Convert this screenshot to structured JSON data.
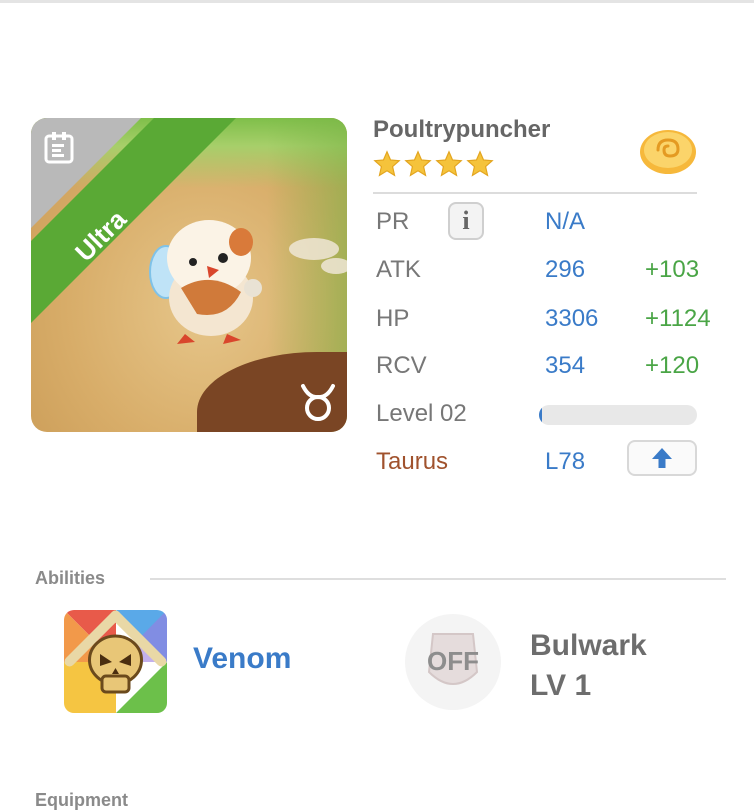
{
  "creature": {
    "name": "Poultrypuncher",
    "rarity": "Ultra",
    "star_count": 4,
    "star_color": "#f5c33b"
  },
  "stats": {
    "pr": {
      "label": "PR",
      "value": "N/A",
      "info_icon": "info-icon"
    },
    "atk": {
      "label": "ATK",
      "value": "296",
      "bonus": "+103"
    },
    "hp": {
      "label": "HP",
      "value": "3306",
      "bonus": "+1124"
    },
    "rcv": {
      "label": "RCV",
      "value": "354",
      "bonus": "+120"
    },
    "level": {
      "label": "Level 02",
      "progress_fraction": 0.02
    },
    "sign": {
      "label": "Taurus",
      "value": "L78",
      "action_icon": "arrow-up-icon"
    }
  },
  "abilities": {
    "title": "Abilities",
    "primary": {
      "name": "Venom",
      "icon": "skull-icon"
    },
    "secondary": {
      "status": "OFF",
      "name": "Bulwark",
      "level": "LV 1"
    }
  },
  "equipment": {
    "title": "Equipment"
  },
  "colors": {
    "accent_blue": "#3a7bc8",
    "bonus_green": "#4aa546",
    "rarity_green": "#5aa935",
    "sign_brown": "#a0522d"
  }
}
